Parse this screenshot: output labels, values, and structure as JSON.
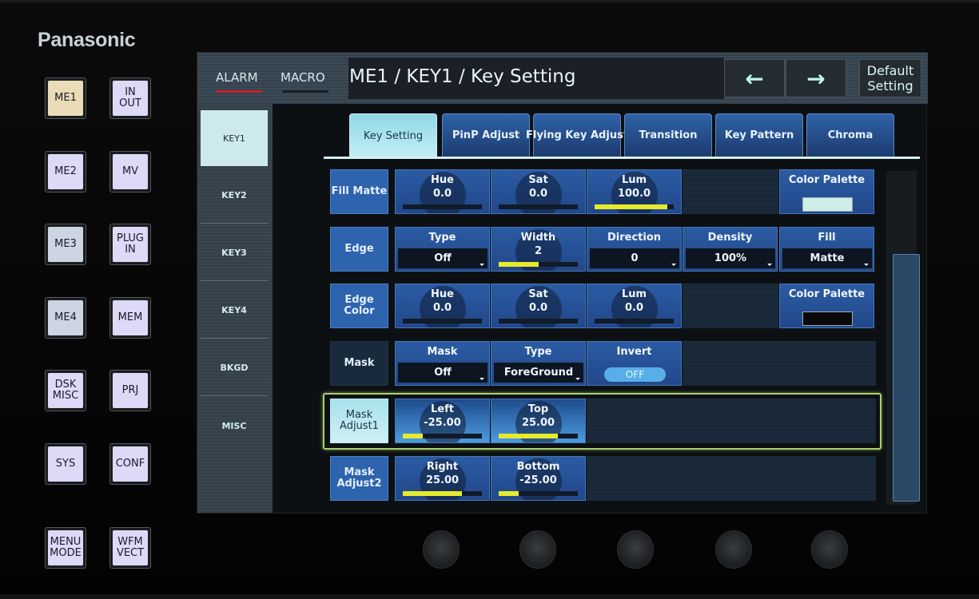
{
  "brand": "Panasonic",
  "hardware_buttons": [
    {
      "label": "ME1",
      "state": "lit-amber"
    },
    {
      "label": "IN\nOUT",
      "state": "lit"
    },
    {
      "label": "ME2",
      "state": "lit"
    },
    {
      "label": "MV",
      "state": "lit"
    },
    {
      "label": "ME3",
      "state": "lit-grey"
    },
    {
      "label": "PLUG\nIN",
      "state": "lit"
    },
    {
      "label": "ME4",
      "state": "lit-grey"
    },
    {
      "label": "MEM",
      "state": "lit"
    },
    {
      "label": "DSK\nMISC",
      "state": "lit"
    },
    {
      "label": "PRJ",
      "state": "lit"
    },
    {
      "label": "SYS",
      "state": "lit"
    },
    {
      "label": "CONF",
      "state": "lit"
    },
    {
      "label": "MENU\nMODE",
      "state": "lit"
    },
    {
      "label": "WFM\nVECT",
      "state": "lit"
    }
  ],
  "header": {
    "alarm_label": "ALARM",
    "alarm_color": "#c8202c",
    "macro_label": "MACRO",
    "macro_color": "#1a1f26",
    "title": "ME1 / KEY1 / Key Setting",
    "back_icon": "←",
    "forward_icon": "→",
    "default_label": "Default\nSetting"
  },
  "sidebar": {
    "items": [
      {
        "label": "KEY1",
        "active": true
      },
      {
        "label": "KEY2"
      },
      {
        "label": "KEY3"
      },
      {
        "label": "KEY4"
      },
      {
        "label": "BKGD"
      },
      {
        "label": "MISC"
      }
    ]
  },
  "tabs": [
    {
      "label": "Key Setting",
      "active": true
    },
    {
      "label": "PinP Adjust"
    },
    {
      "label": "Flying Key Adjust"
    },
    {
      "label": "Transition"
    },
    {
      "label": "Key Pattern"
    },
    {
      "label": "Chroma"
    }
  ],
  "rows": {
    "fill_matte": {
      "label": "Fill Matte",
      "hue": {
        "label": "Hue",
        "value": "0.0",
        "level": 0
      },
      "sat": {
        "label": "Sat",
        "value": "0.0",
        "level": 0
      },
      "lum": {
        "label": "Lum",
        "value": "100.0",
        "level": 0.92
      },
      "palette": {
        "label": "Color Palette",
        "color": "#cdeee6"
      }
    },
    "edge": {
      "label": "Edge",
      "type": {
        "label": "Type",
        "value": "Off"
      },
      "width": {
        "label": "Width",
        "value": "2",
        "level": 0.5
      },
      "direction": {
        "label": "Direction",
        "value": "0"
      },
      "density": {
        "label": "Density",
        "value": "100%"
      },
      "fill": {
        "label": "Fill",
        "value": "Matte"
      }
    },
    "edge_color": {
      "label": "Edge\nColor",
      "hue": {
        "label": "Hue",
        "value": "0.0",
        "level": 0
      },
      "sat": {
        "label": "Sat",
        "value": "0.0",
        "level": 0
      },
      "lum": {
        "label": "Lum",
        "value": "0.0",
        "level": 0
      },
      "palette": {
        "label": "Color Palette",
        "color": "#0a0a0a"
      }
    },
    "mask": {
      "label": "Mask",
      "mask": {
        "label": "Mask",
        "value": "Off"
      },
      "type": {
        "label": "Type",
        "value": "ForeGround"
      },
      "invert": {
        "label": "Invert",
        "value": "OFF"
      }
    },
    "mask_adjust1": {
      "label": "Mask\nAdjust1",
      "left": {
        "label": "Left",
        "value": "-25.00",
        "level": 0.25
      },
      "top": {
        "label": "Top",
        "value": "25.00",
        "level": 0.75
      }
    },
    "mask_adjust2": {
      "label": "Mask\nAdjust2",
      "right": {
        "label": "Right",
        "value": "25.00",
        "level": 0.75
      },
      "bottom": {
        "label": "Bottom",
        "value": "-25.00",
        "level": 0.25
      }
    }
  },
  "colors": {
    "level_bar": "#e6ea2a",
    "selection_frame": "#a9cf74",
    "active_tab": "#c4eef5"
  }
}
